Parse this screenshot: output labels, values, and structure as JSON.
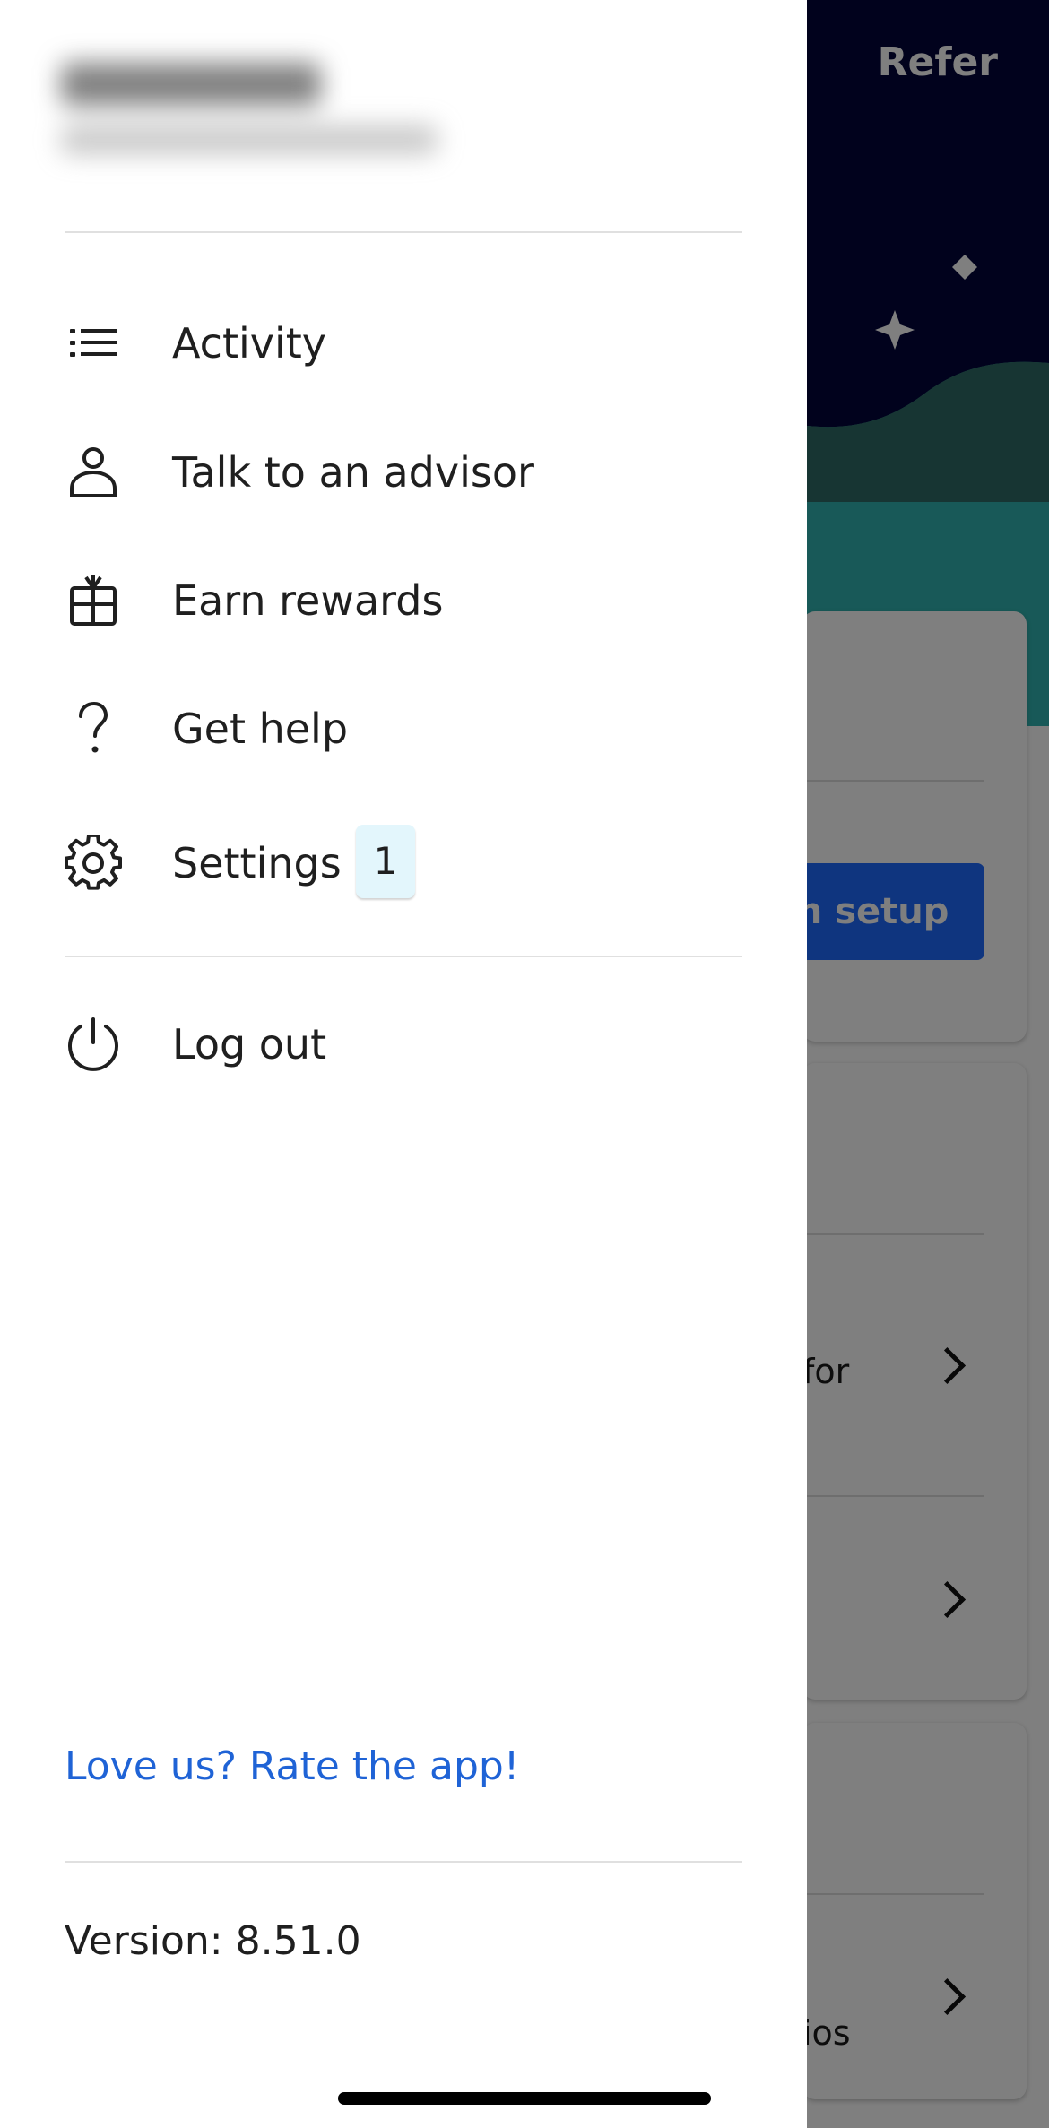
{
  "background": {
    "header_button": "Refer",
    "finish_setup_label": "sh setup",
    "fragment_1": "for",
    "fragment_2": "ios"
  },
  "drawer": {
    "menu": [
      {
        "label": "Activity",
        "icon": "list-icon"
      },
      {
        "label": "Talk to an advisor",
        "icon": "person-icon"
      },
      {
        "label": "Earn rewards",
        "icon": "gift-icon"
      },
      {
        "label": "Get help",
        "icon": "question-icon"
      },
      {
        "label": "Settings",
        "icon": "gear-icon",
        "badge": "1"
      }
    ],
    "logout": {
      "label": "Log out",
      "icon": "power-icon"
    },
    "rate_link": "Love us? Rate the app!",
    "version": "Version: 8.51.0"
  },
  "colors": {
    "link": "#1f63d6",
    "badge_bg": "#e3f6fc",
    "brand_teal": "#30b3b0",
    "night_sky": "#02053a",
    "primary_button": "#1e6bff"
  }
}
